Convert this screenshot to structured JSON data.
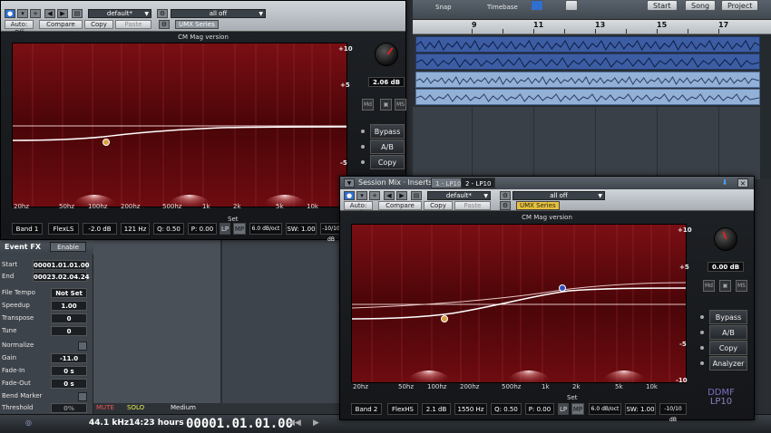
{
  "daw": {
    "top": {
      "snap": "Snap",
      "timebase": "Timebase",
      "start": "Start",
      "song": "Song",
      "project": "Project"
    },
    "ruler": [
      "9",
      "11",
      "13",
      "15",
      "17"
    ],
    "inspector": {
      "title": "Event FX",
      "enable": "Enable",
      "rows": [
        {
          "key": "Start",
          "value": "00001.01.01.00"
        },
        {
          "key": "End",
          "value": "00023.02.04.24"
        },
        {
          "key": "File Tempo",
          "value": "Not Set"
        },
        {
          "key": "Speedup",
          "value": "1.00"
        },
        {
          "key": "Transpose",
          "value": "0"
        },
        {
          "key": "Tune",
          "value": "0"
        },
        {
          "key": "Normalize",
          "value": ""
        },
        {
          "key": "Gain",
          "value": "-11.0"
        },
        {
          "key": "Fade-In",
          "value": "0 s"
        },
        {
          "key": "Fade-Out",
          "value": "0 s"
        },
        {
          "key": "Bend Marker",
          "value": ""
        },
        {
          "key": "Threshold",
          "value": "0%"
        }
      ]
    },
    "mutesolo": {
      "mute": "MUTE",
      "solo": "SOLO",
      "medium": "Medium"
    },
    "transport": {
      "rate": "44.1 kHz",
      "hours": "14:23 hours",
      "position": "00001.01.01.00"
    }
  },
  "plugin1": {
    "preset": "default*",
    "alloff": "all off",
    "autooff": "Auto: Off",
    "compare": "Compare",
    "copy": "Copy",
    "paste": "Paste",
    "umx": "UMX Series",
    "cm": "CM Mag version",
    "gain": "2.06 dB",
    "db": [
      "+10",
      "+5",
      "-5"
    ],
    "freqs": [
      "20hz",
      "50hz",
      "100hz",
      "200hz",
      "500hz",
      "1k",
      "2k",
      "5k",
      "10k"
    ],
    "set": "Set",
    "md": "Md",
    "ms": "MS",
    "side": [
      "Bypass",
      "A/B",
      "Copy"
    ],
    "band": "Band 1",
    "type": "FlexLS",
    "bgain": "-2.0 dB",
    "freq": "121 Hz",
    "q": "Q: 0.50",
    "p": "P: 0.00",
    "lp": "LP",
    "mp": "MP",
    "slope": "6.0 dB/oct",
    "sw": "SW: 1.00",
    "range": "-10/10 dB"
  },
  "plugin2": {
    "title": "Session Mix · Inserts",
    "tab1": "1 - LP10",
    "tab2": "2 - LP10",
    "preset": "default*",
    "alloff": "all off",
    "autooff": "Auto: Off",
    "compare": "Compare",
    "copy": "Copy",
    "paste": "Paste",
    "umx": "UMX Series",
    "cm": "CM Mag version",
    "gain": "0.00 dB",
    "db": [
      "+10",
      "+5",
      "-5",
      "-10"
    ],
    "freqs": [
      "20hz",
      "50hz",
      "100hz",
      "200hz",
      "500hz",
      "1k",
      "2k",
      "5k",
      "10k"
    ],
    "set": "Set",
    "md": "Md",
    "ms": "MS",
    "side": [
      "Bypass",
      "A/B",
      "Copy",
      "Analyzer"
    ],
    "band": "Band 2",
    "type": "FlexHS",
    "bgain": "2.1 dB",
    "freq": "1550 Hz",
    "q": "Q: 0.50",
    "p": "P: 0.00",
    "lp": "LP",
    "mp": "MP",
    "slope": "6.0 dB/oct",
    "sw": "SW: 1.00",
    "range": "-10/10 dB",
    "brand1": "DDMF",
    "brand2": "LP10"
  },
  "colors": {
    "accent": "#2f6fd0",
    "eq_bg": "#5a0a0e",
    "umx_gold": "#e8c23a"
  }
}
